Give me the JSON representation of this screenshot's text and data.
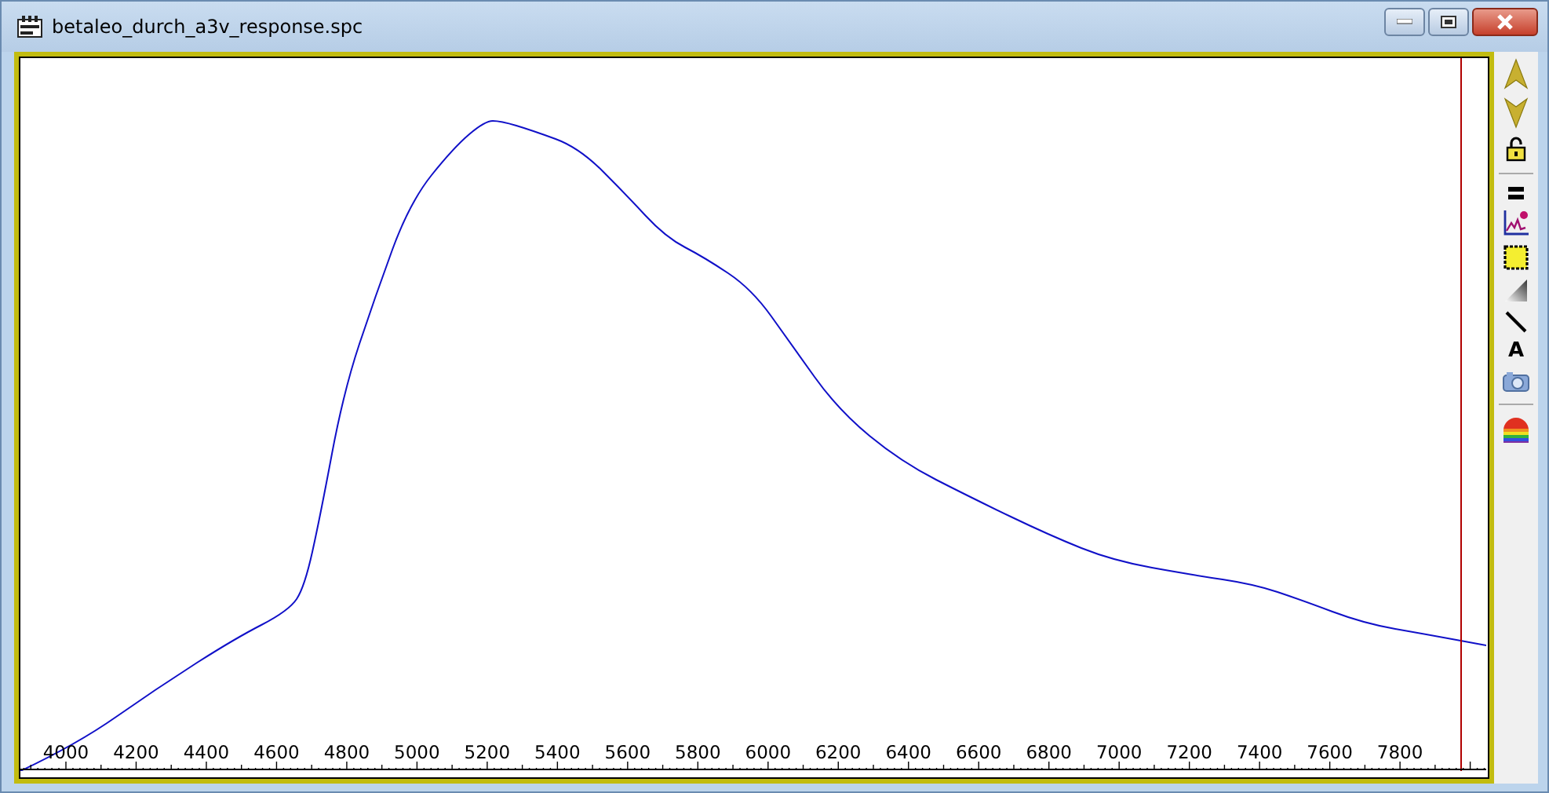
{
  "window": {
    "title": "betaleo_durch_a3v_response.spc"
  },
  "plot": {
    "x_ticks": [
      "4000",
      "4200",
      "4400",
      "4600",
      "4800",
      "5000",
      "5200",
      "5400",
      "5600",
      "5800",
      "6000",
      "6200",
      "6400",
      "6600",
      "6800",
      "7000",
      "7200",
      "7400",
      "7600",
      "7800"
    ]
  },
  "toolbar": [
    {
      "kind": "up"
    },
    {
      "kind": "down"
    },
    {
      "kind": "lock"
    },
    {
      "kind": "separator"
    },
    {
      "kind": "equal"
    },
    {
      "kind": "chart"
    },
    {
      "kind": "select"
    },
    {
      "kind": "gradient"
    },
    {
      "kind": "line"
    },
    {
      "kind": "text",
      "label": "A"
    },
    {
      "kind": "camera"
    },
    {
      "kind": "separator"
    },
    {
      "kind": "rainbow"
    }
  ]
}
